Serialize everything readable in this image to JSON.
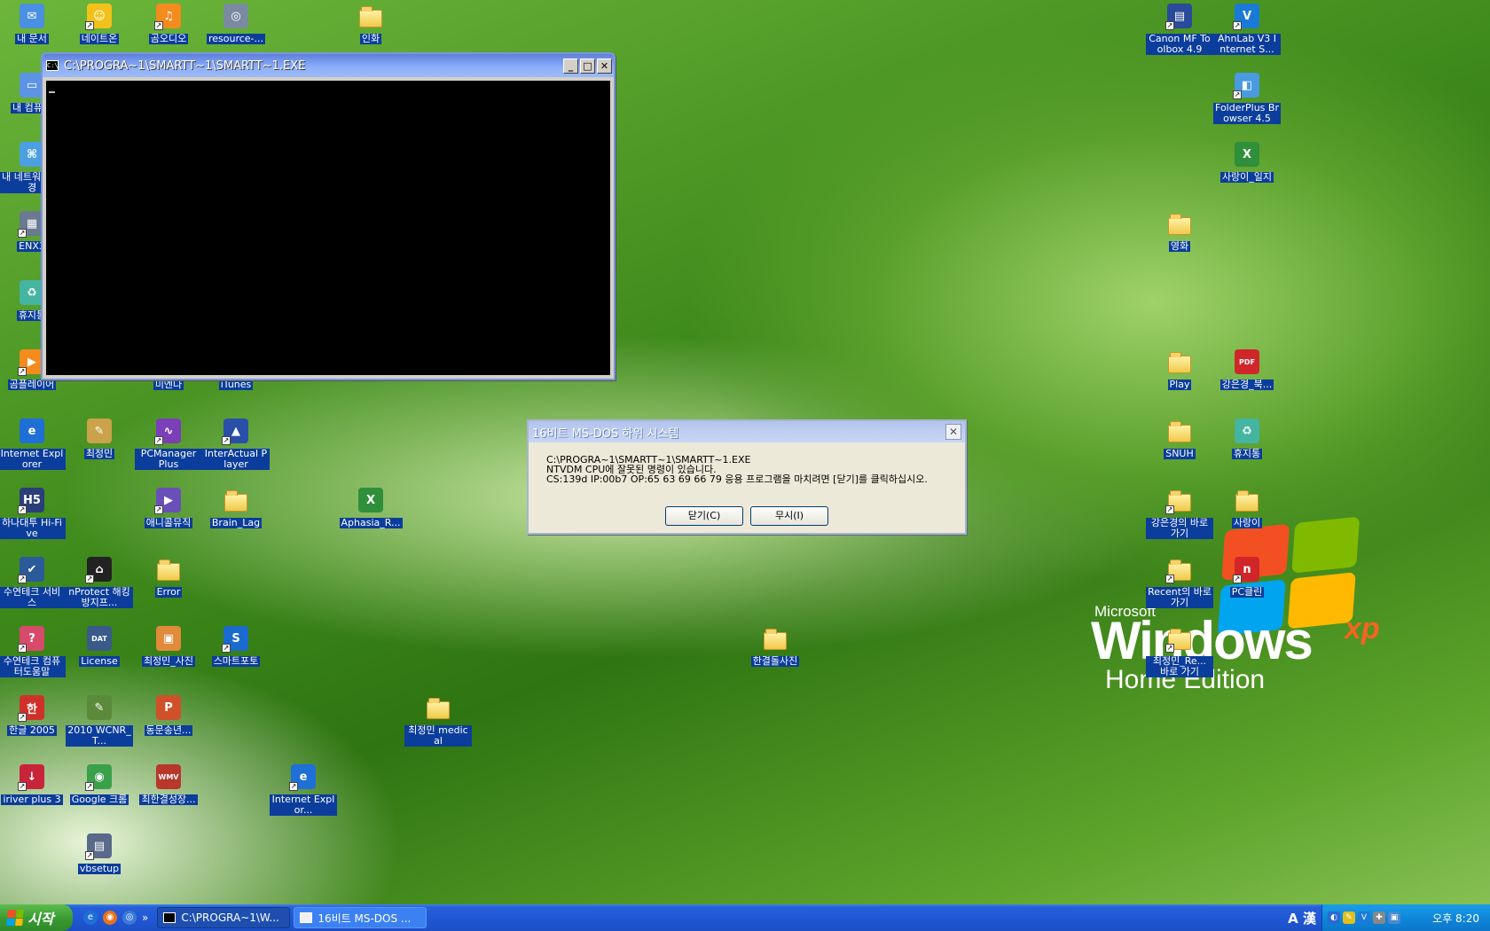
{
  "desktop": {
    "icons": [
      {
        "label": "내 문서",
        "icon": "my-documents-icon",
        "kind": "app",
        "color": "#4a8fe0",
        "glyph": "✉",
        "shortcut": false
      },
      {
        "label": "네이트온",
        "icon": "nateon-icon",
        "kind": "app",
        "color": "#f2c21b",
        "glyph": "☺",
        "shortcut": true
      },
      {
        "label": "곰오디오",
        "icon": "gom-audio-icon",
        "kind": "app",
        "color": "#f38b1d",
        "glyph": "♫",
        "shortcut": true
      },
      {
        "label": "resource-...",
        "icon": "resource-file-icon",
        "kind": "app",
        "color": "#7a8aa0",
        "glyph": "◎",
        "shortcut": false
      },
      {
        "label": "인화",
        "icon": "folder-icon",
        "kind": "folder",
        "shortcut": false
      },
      {
        "label": "내 컴퓨터",
        "icon": "my-computer-icon",
        "kind": "app",
        "color": "#5c94e3",
        "glyph": "▭",
        "shortcut": false
      },
      {
        "label": "내 네트워크 환경",
        "icon": "network-icon",
        "kind": "app",
        "color": "#4aa0e0",
        "glyph": "⌘",
        "shortcut": false
      },
      {
        "label": "ENX3",
        "icon": "enx3-icon",
        "kind": "app",
        "color": "#6a7a90",
        "glyph": "▦",
        "shortcut": true
      },
      {
        "label": "휴지통",
        "icon": "recycle-bin-icon",
        "kind": "app",
        "color": "#43b5a0",
        "glyph": "♻",
        "shortcut": false
      },
      {
        "label": "곰플레이어",
        "icon": "gom-player-icon",
        "kind": "app",
        "color": "#f38b1d",
        "glyph": "▶",
        "shortcut": true
      },
      {
        "label": "미엔다",
        "icon": "app-icon",
        "kind": "app",
        "color": "#8a6ad0",
        "glyph": "◆",
        "shortcut": true
      },
      {
        "label": "iTunes",
        "icon": "itunes-icon",
        "kind": "app",
        "color": "#5a8ad8",
        "glyph": "♪",
        "shortcut": true
      },
      {
        "label": "Internet Explorer",
        "icon": "internet-explorer-icon",
        "kind": "app",
        "color": "#1e6fd6",
        "glyph": "e",
        "shortcut": false
      },
      {
        "label": "최정민",
        "icon": "user-folder-icon",
        "kind": "app",
        "color": "#c9a24a",
        "glyph": "✎",
        "shortcut": false
      },
      {
        "label": "PCManager Plus",
        "icon": "pcmanager-icon",
        "kind": "app",
        "color": "#7b3fb8",
        "glyph": "∿",
        "shortcut": true
      },
      {
        "label": "InterActual Player",
        "icon": "interactual-player-icon",
        "kind": "app",
        "color": "#2a4fa8",
        "glyph": "▲",
        "shortcut": true
      },
      {
        "label": "하나대투 Hi-Five",
        "icon": "hi-five-icon",
        "kind": "app",
        "color": "#2a3f7a",
        "glyph": "H5",
        "shortcut": true
      },
      {
        "label": "애니콜뮤직",
        "icon": "anycall-music-icon",
        "kind": "app",
        "color": "#6a4fb8",
        "glyph": "▶",
        "shortcut": true
      },
      {
        "label": "Brain_Lag",
        "icon": "folder-icon",
        "kind": "folder",
        "shortcut": false
      },
      {
        "label": "Aphasia_R...",
        "icon": "excel-file-icon",
        "kind": "app",
        "color": "#2f8f3a",
        "glyph": "X",
        "shortcut": false
      },
      {
        "label": "수연테크 서비스",
        "icon": "service-icon",
        "kind": "app",
        "color": "#2a5a9a",
        "glyph": "✔",
        "shortcut": true
      },
      {
        "label": "nProtect 해킹방지프...",
        "icon": "nprotect-icon",
        "kind": "app",
        "color": "#222222",
        "glyph": "⌂",
        "shortcut": true
      },
      {
        "label": "Error",
        "icon": "folder-icon",
        "kind": "folder",
        "shortcut": false
      },
      {
        "label": "수연테크 컴퓨터도움말",
        "icon": "help-icon",
        "kind": "app",
        "color": "#d84a6a",
        "glyph": "?",
        "shortcut": true
      },
      {
        "label": "License",
        "icon": "license-dat-icon",
        "kind": "app",
        "color": "#3a5a8a",
        "glyph": "DAT",
        "shortcut": false
      },
      {
        "label": "최정민_사진",
        "icon": "photo-icon",
        "kind": "app",
        "color": "#e08a3a",
        "glyph": "▣",
        "shortcut": false
      },
      {
        "label": "스마트포토",
        "icon": "smartphoto-icon",
        "kind": "app",
        "color": "#1a6ad0",
        "glyph": "S",
        "shortcut": true
      },
      {
        "label": "한결돌사진",
        "icon": "folder-icon",
        "kind": "folder",
        "shortcut": false
      },
      {
        "label": "한글 2005",
        "icon": "hangul-icon",
        "kind": "app",
        "color": "#d0302a",
        "glyph": "한",
        "shortcut": true
      },
      {
        "label": "2010 WCNR_T...",
        "icon": "document-icon",
        "kind": "app",
        "color": "#5a8a3a",
        "glyph": "✎",
        "shortcut": false
      },
      {
        "label": "동문송년...",
        "icon": "ppt-file-icon",
        "kind": "app",
        "color": "#d0502a",
        "glyph": "P",
        "shortcut": false
      },
      {
        "label": "최정민 medical",
        "icon": "folder-icon",
        "kind": "folder",
        "shortcut": false
      },
      {
        "label": "iriver plus 3",
        "icon": "iriver-icon",
        "kind": "app",
        "color": "#c8243a",
        "glyph": "↓",
        "shortcut": true
      },
      {
        "label": "Google 크롬",
        "icon": "chrome-icon",
        "kind": "app",
        "color": "#3aa04a",
        "glyph": "◉",
        "shortcut": true
      },
      {
        "label": "최한결성장...",
        "icon": "wmv-file-icon",
        "kind": "app",
        "color": "#b8362a",
        "glyph": "WMV",
        "shortcut": false
      },
      {
        "label": "Internet Explor...",
        "icon": "internet-explorer-icon",
        "kind": "app",
        "color": "#1e6fd6",
        "glyph": "e",
        "shortcut": true
      },
      {
        "label": "vbsetup",
        "icon": "setup-icon",
        "kind": "app",
        "color": "#5a6a8a",
        "glyph": "▤",
        "shortcut": true
      },
      {
        "label": "Canon MF Toolbox 4.9",
        "icon": "canon-toolbox-icon",
        "kind": "app",
        "color": "#2a4a9a",
        "glyph": "▤",
        "shortcut": true
      },
      {
        "label": "AhnLab V3 Internet S...",
        "icon": "ahnlab-v3-icon",
        "kind": "app",
        "color": "#1a7ad8",
        "glyph": "V",
        "shortcut": true
      },
      {
        "label": "FolderPlus Browser 4.5",
        "icon": "folderplus-icon",
        "kind": "app",
        "color": "#4a9ae0",
        "glyph": "◧",
        "shortcut": true
      },
      {
        "label": "사랑이_일지",
        "icon": "excel-file-icon",
        "kind": "app",
        "color": "#2f8f3a",
        "glyph": "X",
        "shortcut": false
      },
      {
        "label": "영화",
        "icon": "folder-icon",
        "kind": "folder",
        "shortcut": false
      },
      {
        "label": "Play",
        "icon": "folder-icon",
        "kind": "folder",
        "shortcut": false
      },
      {
        "label": "강은경_북...",
        "icon": "pdf-file-icon",
        "kind": "app",
        "color": "#d0262a",
        "glyph": "PDF",
        "shortcut": false
      },
      {
        "label": "SNUH",
        "icon": "folder-icon",
        "kind": "folder",
        "shortcut": false
      },
      {
        "label": "휴지통",
        "icon": "recycle-bin-icon",
        "kind": "app",
        "color": "#43b5a0",
        "glyph": "♻",
        "shortcut": false
      },
      {
        "label": "강은경의 바로 가기",
        "icon": "folder-icon",
        "kind": "folder",
        "shortcut": true
      },
      {
        "label": "사랑이",
        "icon": "folder-icon",
        "kind": "folder",
        "shortcut": false
      },
      {
        "label": "Recent의 바로 가기",
        "icon": "folder-icon",
        "kind": "folder",
        "shortcut": true
      },
      {
        "label": "PC클린",
        "icon": "pc-clean-icon",
        "kind": "app",
        "color": "#d0262a",
        "glyph": "n",
        "shortcut": true
      },
      {
        "label": "최정민_Re... 바로 가기",
        "icon": "folder-icon",
        "kind": "folder",
        "shortcut": true
      }
    ]
  },
  "console": {
    "title": "C:\\PROGRA~1\\SMARTT~1\\SMARTT~1.EXE",
    "icon_text": "C:\\",
    "minimize": "_",
    "maximize": "□",
    "close": "✕"
  },
  "dialog": {
    "title": "16비트 MS-DOS 하위 시스템",
    "close": "✕",
    "lines": [
      "C:\\PROGRA~1\\SMARTT~1\\SMARTT~1.EXE",
      "NTVDM CPU에 잘못된 명령이 있습니다.",
      "CS:139d IP:00b7 OP:65 63 69 66 79 응용 프로그램을 마치려면 [닫기]를 클릭하십시오."
    ],
    "close_button": "닫기(C)",
    "ignore_button": "무시(I)"
  },
  "logo": {
    "microsoft": "Microsoft",
    "windows": "Windows",
    "xp": "xp",
    "edition": "Home Edition",
    "tm": "™"
  },
  "taskbar": {
    "start_label": "시작",
    "quick_launch": [
      {
        "icon": "ie-quicklaunch-icon",
        "color": "#1e6fd6",
        "glyph": "e"
      },
      {
        "icon": "firefox-quicklaunch-icon",
        "color": "#e8711a",
        "glyph": "◉"
      },
      {
        "icon": "media-quicklaunch-icon",
        "color": "#3a7ad8",
        "glyph": "◎"
      }
    ],
    "more": "»",
    "tasks": [
      {
        "label": "C:\\PROGRA~1\\W...",
        "icon": "console-task-icon",
        "active": true
      },
      {
        "label": "16비트 MS-DOS ...",
        "icon": "dialog-task-icon",
        "active": false
      }
    ],
    "ime": "A 漢",
    "tray_icons": [
      {
        "icon": "network-tray-icon",
        "color": "#2a6ad0",
        "glyph": "◐"
      },
      {
        "icon": "pen-tray-icon",
        "color": "#e0c020",
        "glyph": "✎"
      },
      {
        "icon": "v3-tray-icon",
        "color": "#1a7ad8",
        "glyph": "V"
      },
      {
        "icon": "wrench-tray-icon",
        "color": "#888888",
        "glyph": "✚"
      },
      {
        "icon": "display-tray-icon",
        "color": "#4a8ad0",
        "glyph": "▣"
      }
    ],
    "clock": "오후 8:20"
  }
}
